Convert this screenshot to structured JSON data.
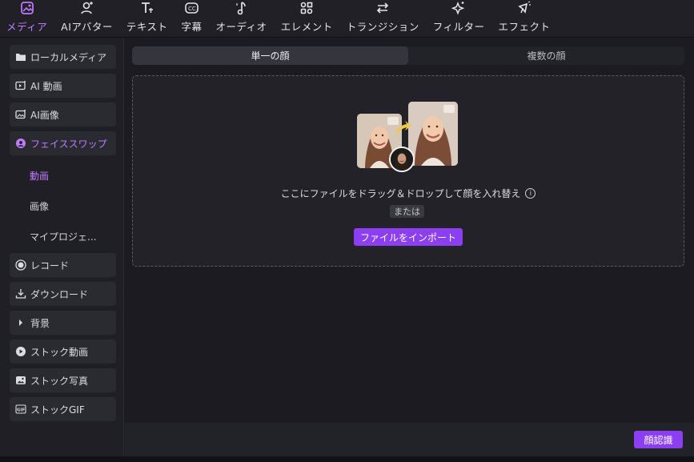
{
  "toolbar": {
    "items": [
      {
        "label": "メディア",
        "icon": "media-icon",
        "active": true
      },
      {
        "label": "AIアバター",
        "icon": "ai-avatar-icon",
        "active": false
      },
      {
        "label": "テキスト",
        "icon": "text-icon",
        "active": false
      },
      {
        "label": "字幕",
        "icon": "caption-icon",
        "active": false
      },
      {
        "label": "オーディオ",
        "icon": "audio-icon",
        "active": false
      },
      {
        "label": "エレメント",
        "icon": "element-icon",
        "active": false
      },
      {
        "label": "トランジション",
        "icon": "transition-icon",
        "active": false
      },
      {
        "label": "フィルター",
        "icon": "filter-icon",
        "active": false
      },
      {
        "label": "エフェクト",
        "icon": "effect-icon",
        "active": false
      }
    ]
  },
  "sidebar": {
    "items": [
      {
        "label": "ローカルメディア",
        "icon": "folder-icon"
      },
      {
        "label": "AI 動画",
        "icon": "ai-video-icon"
      },
      {
        "label": "AI画像",
        "icon": "ai-image-icon"
      },
      {
        "label": "フェイススワップ",
        "icon": "face-swap-icon"
      },
      {
        "label": "レコード",
        "icon": "record-icon"
      },
      {
        "label": "ダウンロード",
        "icon": "download-icon"
      },
      {
        "label": "背景",
        "icon": "caret-right-icon"
      },
      {
        "label": "ストック動画",
        "icon": "stock-video-icon"
      },
      {
        "label": "ストック写真",
        "icon": "stock-photo-icon"
      },
      {
        "label": "ストックGIF",
        "icon": "gif-icon"
      }
    ],
    "sub_items": [
      {
        "label": "動画"
      },
      {
        "label": "画像"
      },
      {
        "label": "マイプロジェ..."
      }
    ]
  },
  "main": {
    "tabs": [
      {
        "label": "単一の顔"
      },
      {
        "label": "複数の顔"
      }
    ],
    "drop_text": "ここにファイルをドラッグ＆ドロップして顔を入れ替え",
    "or_label": "または",
    "import_button": "ファイルをインポート"
  },
  "bottom": {
    "recognize_button": "顔認識"
  },
  "colors": {
    "accent": "#8b3ff0",
    "active_text": "#c07bff",
    "background": "#1b1b20"
  }
}
